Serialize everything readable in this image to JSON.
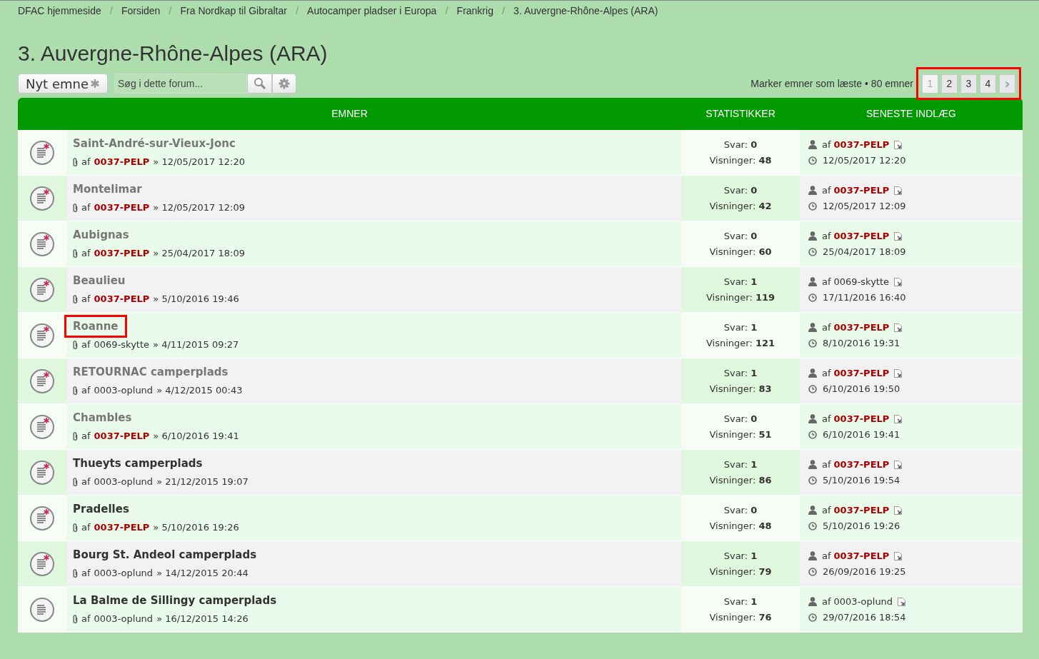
{
  "breadcrumbs": [
    {
      "label": "DFAC hjemmeside"
    },
    {
      "separator": "/",
      "label": "Forsiden"
    },
    {
      "separator": "/",
      "label": "Fra Nordkap til Gibraltar"
    },
    {
      "separator": "/",
      "label": "Autocamper pladser i Europa"
    },
    {
      "separator": "/",
      "label": "Frankrig"
    },
    {
      "separator": "/",
      "label": "3. Auvergne-Rhône-Alpes (ARA)"
    }
  ],
  "title": "3. Auvergne-Rhône-Alpes (ARA)",
  "toolbar": {
    "new_topic": "Nyt emne",
    "search": {
      "placeholder": "Søg i dette forum..."
    }
  },
  "summary": {
    "mark_read": "Marker emner som læste",
    "separator": "•",
    "count": "80 emner"
  },
  "pagination": {
    "highlighted": true,
    "pages": [
      {
        "label": "1",
        "selected": true
      },
      {
        "label": "2",
        "selected": false
      },
      {
        "label": "3",
        "selected": false
      },
      {
        "label": "4",
        "selected": false
      }
    ],
    "next": "›"
  },
  "table": {
    "columns": [
      "EMNER",
      "STATISTIKKER",
      "SENESTE INDLÆG"
    ],
    "rows": [
      {
        "title": "Saint-André-sur-Vieux-Jonc",
        "read": true,
        "posted": true,
        "highlighted": false,
        "by": "af",
        "author": "0037-PELP",
        "author_highlighted": true,
        "date": "» 12/05/2017 12:20",
        "replies_label": "Svar:",
        "replies": "0",
        "views_label": "Visninger:",
        "views": "48",
        "last_by": "af",
        "last_author": "0037-PELP",
        "last_highlighted": true,
        "last_date": "12/05/2017 12:20"
      },
      {
        "title": "Montelimar",
        "read": true,
        "posted": true,
        "highlighted": false,
        "by": "af",
        "author": "0037-PELP",
        "author_highlighted": true,
        "date": "» 12/05/2017 12:09",
        "replies_label": "Svar:",
        "replies": "0",
        "views_label": "Visninger:",
        "views": "42",
        "last_by": "af",
        "last_author": "0037-PELP",
        "last_highlighted": true,
        "last_date": "12/05/2017 12:09"
      },
      {
        "title": "Aubignas",
        "read": true,
        "posted": true,
        "highlighted": false,
        "by": "af",
        "author": "0037-PELP",
        "author_highlighted": true,
        "date": "» 25/04/2017 18:09",
        "replies_label": "Svar:",
        "replies": "0",
        "views_label": "Visninger:",
        "views": "60",
        "last_by": "af",
        "last_author": "0037-PELP",
        "last_highlighted": true,
        "last_date": "25/04/2017 18:09"
      },
      {
        "title": "Beaulieu",
        "read": true,
        "posted": true,
        "highlighted": false,
        "by": "af",
        "author": "0037-PELP",
        "author_highlighted": true,
        "date": "» 5/10/2016 19:46",
        "replies_label": "Svar:",
        "replies": "1",
        "views_label": "Visninger:",
        "views": "119",
        "last_by": "af",
        "last_author": "0069-skytte",
        "last_highlighted": false,
        "last_date": "17/11/2016 16:40"
      },
      {
        "title": "Roanne",
        "read": true,
        "posted": true,
        "highlighted": true,
        "by": "af",
        "author": "0069-skytte",
        "author_highlighted": false,
        "date": "» 4/11/2015 09:27",
        "replies_label": "Svar:",
        "replies": "1",
        "views_label": "Visninger:",
        "views": "121",
        "last_by": "af",
        "last_author": "0037-PELP",
        "last_highlighted": true,
        "last_date": "8/10/2016 19:31"
      },
      {
        "title": "RETOURNAC camperplads",
        "read": true,
        "posted": true,
        "highlighted": false,
        "by": "af",
        "author": "0003-oplund",
        "author_highlighted": false,
        "date": "» 4/12/2015 00:43",
        "replies_label": "Svar:",
        "replies": "1",
        "views_label": "Visninger:",
        "views": "83",
        "last_by": "af",
        "last_author": "0037-PELP",
        "last_highlighted": true,
        "last_date": "6/10/2016 19:50"
      },
      {
        "title": "Chambles",
        "read": true,
        "posted": true,
        "highlighted": false,
        "by": "af",
        "author": "0037-PELP",
        "author_highlighted": true,
        "date": "» 6/10/2016 19:41",
        "replies_label": "Svar:",
        "replies": "0",
        "views_label": "Visninger:",
        "views": "51",
        "last_by": "af",
        "last_author": "0037-PELP",
        "last_highlighted": true,
        "last_date": "6/10/2016 19:41"
      },
      {
        "title": "Thueyts camperplads",
        "read": false,
        "posted": true,
        "highlighted": false,
        "by": "af",
        "author": "0003-oplund",
        "author_highlighted": false,
        "date": "» 21/12/2015 19:07",
        "replies_label": "Svar:",
        "replies": "1",
        "views_label": "Visninger:",
        "views": "86",
        "last_by": "af",
        "last_author": "0037-PELP",
        "last_highlighted": true,
        "last_date": "5/10/2016 19:54"
      },
      {
        "title": "Pradelles",
        "read": false,
        "posted": true,
        "highlighted": false,
        "by": "af",
        "author": "0037-PELP",
        "author_highlighted": true,
        "date": "» 5/10/2016 19:26",
        "replies_label": "Svar:",
        "replies": "0",
        "views_label": "Visninger:",
        "views": "48",
        "last_by": "af",
        "last_author": "0037-PELP",
        "last_highlighted": true,
        "last_date": "5/10/2016 19:26"
      },
      {
        "title": "Bourg St. Andeol camperplads",
        "read": false,
        "posted": true,
        "highlighted": false,
        "by": "af",
        "author": "0003-oplund",
        "author_highlighted": false,
        "date": "» 14/12/2015 20:44",
        "replies_label": "Svar:",
        "replies": "1",
        "views_label": "Visninger:",
        "views": "79",
        "last_by": "af",
        "last_author": "0037-PELP",
        "last_highlighted": true,
        "last_date": "26/09/2016 19:25"
      },
      {
        "title": "La Balme de Sillingy camperplads",
        "read": false,
        "posted": false,
        "highlighted": false,
        "by": "af",
        "author": "0003-oplund",
        "author_highlighted": false,
        "date": "» 16/12/2015 14:26",
        "replies_label": "Svar:",
        "replies": "1",
        "views_label": "Visninger:",
        "views": "76",
        "last_by": "af",
        "last_author": "0003-oplund",
        "last_highlighted": false,
        "last_date": "29/07/2016 18:54"
      }
    ]
  }
}
